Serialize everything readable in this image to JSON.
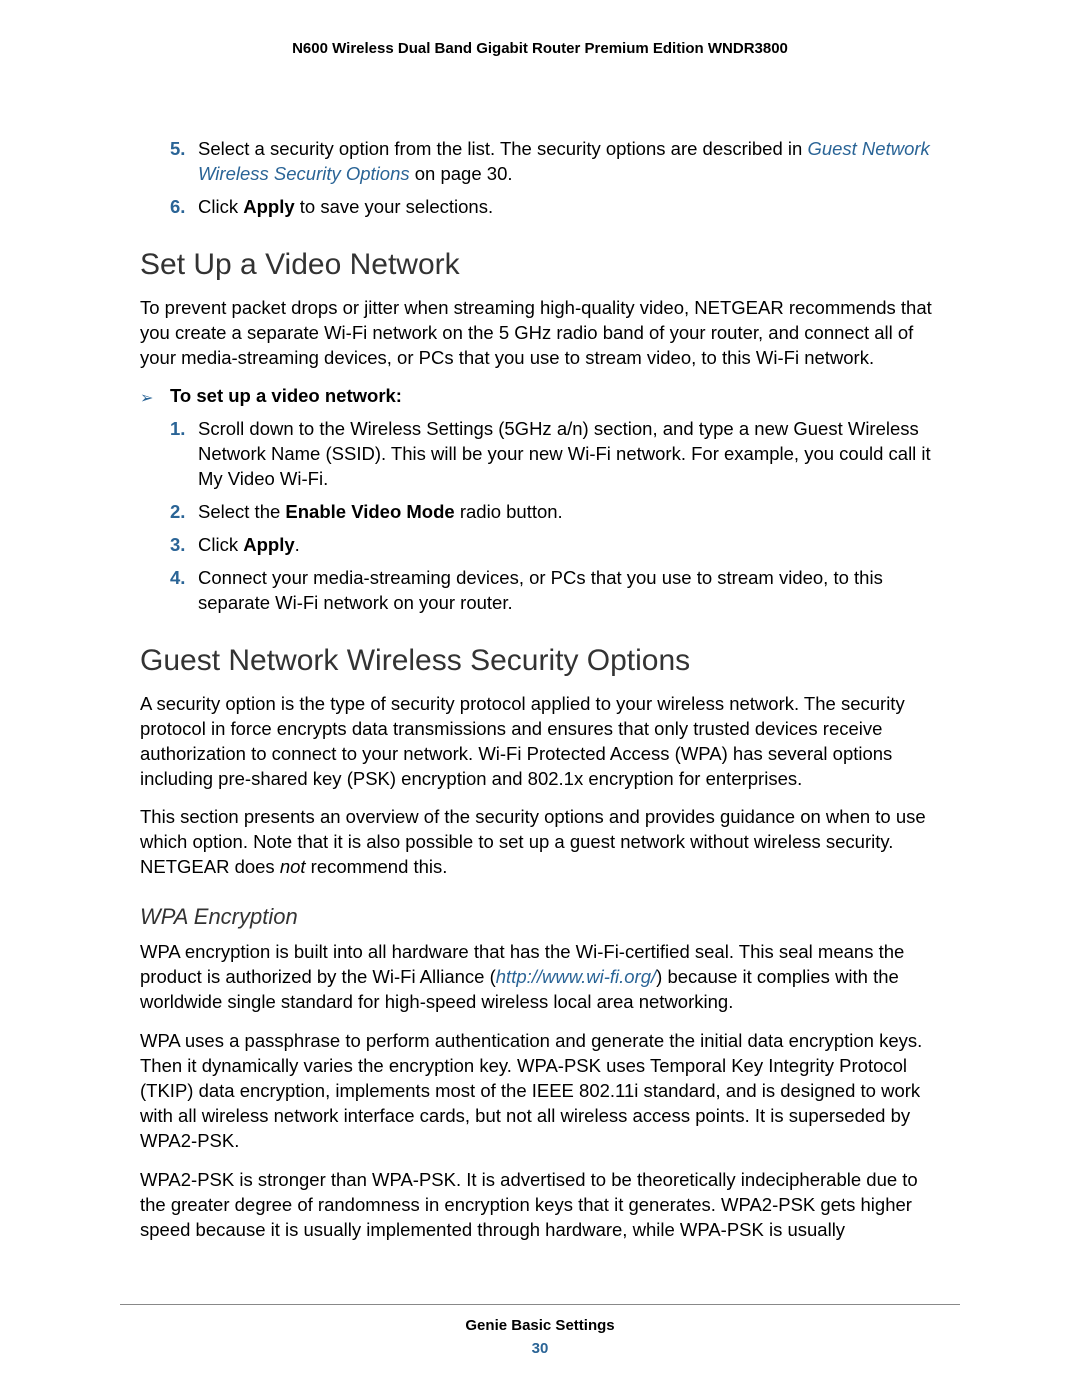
{
  "header": {
    "title": "N600 Wireless Dual Band Gigabit Router Premium Edition WNDR3800"
  },
  "intro_steps": [
    {
      "num": "5.",
      "text_before_link": "Select a security option from the list. The security options are described in ",
      "link": "Guest Network Wireless Security Options",
      "text_after_link": " on page 30."
    },
    {
      "num": "6.",
      "text_before_bold": "Click ",
      "bold": "Apply",
      "text_after_bold": " to save your selections."
    }
  ],
  "section1": {
    "heading": "Set Up a Video Network",
    "intro": "To prevent packet drops or jitter when streaming high-quality video, NETGEAR recommends that you create a separate Wi-Fi network on the 5 GHz radio band of your router, and connect all of your media-streaming devices, or PCs that you use to stream video, to this Wi-Fi network.",
    "procedure_label": "To set up a video network:",
    "steps": [
      {
        "num": "1.",
        "plain": "Scroll down to the Wireless Settings (5GHz a/n) section, and type a new Guest Wireless Network Name (SSID). This will be your new Wi-Fi network. For example, you could call it My Video Wi-Fi."
      },
      {
        "num": "2.",
        "before": "Select the ",
        "bold": "Enable Video Mode",
        "after": " radio button."
      },
      {
        "num": "3.",
        "before": "Click ",
        "bold": "Apply",
        "after": "."
      },
      {
        "num": "4.",
        "plain": "Connect your media-streaming devices, or PCs that you use to stream video, to this separate Wi-Fi network on your router."
      }
    ]
  },
  "section2": {
    "heading": "Guest Network Wireless Security Options",
    "p1": "A security option is the type of security protocol applied to your wireless network. The security protocol in force encrypts data transmissions and ensures that only trusted devices receive authorization to connect to your network. Wi-Fi Protected Access (WPA) has several options including pre-shared key (PSK) encryption and 802.1x encryption for enterprises.",
    "p2_before": "This section presents an overview of the security options and provides guidance on when to use which option. Note that it is also possible to set up a guest network without wireless security. NETGEAR does ",
    "p2_italic": "not",
    "p2_after": " recommend this."
  },
  "section3": {
    "heading": "WPA Encryption",
    "p1_before": "WPA encryption is built into all hardware that has the Wi-Fi-certified seal. This seal means the product is authorized by the Wi-Fi Alliance (",
    "p1_link": "http://www.wi-fi.org/",
    "p1_after": ") because it complies with the worldwide single standard for high-speed wireless local area networking.",
    "p2": "WPA uses a passphrase to perform authentication and generate the initial data encryption keys. Then it dynamically varies the encryption key. WPA-PSK uses Temporal Key Integrity Protocol (TKIP) data encryption, implements most of the IEEE 802.11i standard, and is designed to work with all wireless network interface cards, but not all wireless access points. It is superseded by WPA2-PSK.",
    "p3": "WPA2-PSK is stronger than WPA-PSK. It is advertised to be theoretically indecipherable due to the greater degree of randomness in encryption keys that it generates. WPA2-PSK gets higher speed because it is usually implemented through hardware, while WPA-PSK is usually"
  },
  "footer": {
    "section": "Genie Basic Settings",
    "page": "30"
  }
}
